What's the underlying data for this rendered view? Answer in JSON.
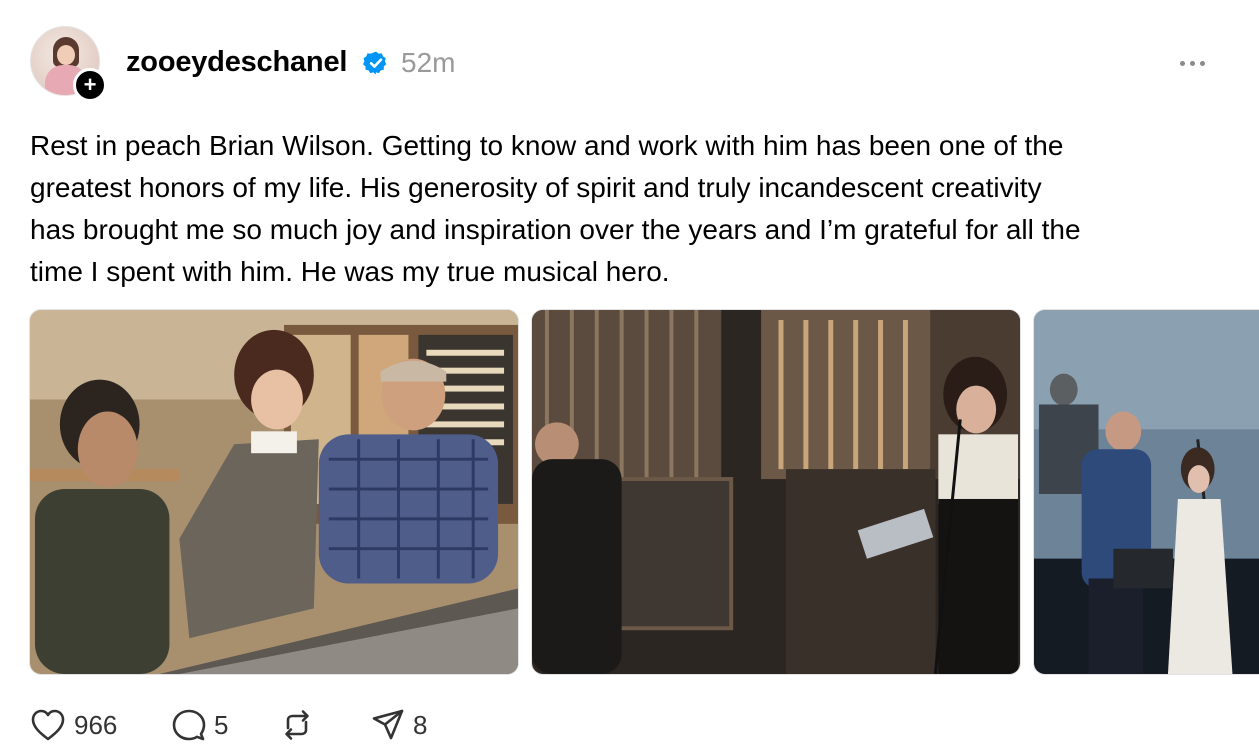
{
  "post": {
    "username": "zooeydeschanel",
    "verified": true,
    "time_ago": "52m",
    "text": "Rest in peach Brian Wilson. Getting to know and work with him has been one of the\ngreatest honors of my life. His generosity of spirit and truly incandescent creativity\nhas brought me so much joy and inspiration over the years and I’m grateful for all the\ntime I spent with him. He was my true musical hero.",
    "follow_badge": "+"
  },
  "icons": {
    "more": "more-horizontal-icon",
    "like": "heart-icon",
    "reply": "comment-icon",
    "repost": "repost-icon",
    "share": "send-icon",
    "verified": "verified-badge-icon"
  },
  "stats": {
    "likes": "966",
    "replies": "5",
    "shares": "8"
  },
  "colors": {
    "verified_blue": "#0095f6",
    "muted_text": "#999999",
    "icon_gray": "#333333"
  }
}
